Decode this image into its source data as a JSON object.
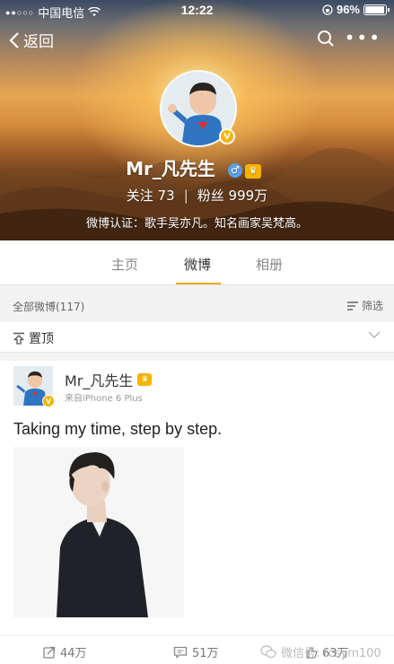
{
  "status_bar": {
    "carrier": "中国电信",
    "time": "12:22",
    "battery": "96%"
  },
  "nav": {
    "back_label": "返回"
  },
  "profile": {
    "name": "Mr_凡先生",
    "follow_label": "关注",
    "follow_count": "73",
    "fans_label": "粉丝",
    "fans_count": "999万",
    "verification": "微博认证：歌手吴亦凡。知名画家吴梵高。"
  },
  "tabs": [
    {
      "label": "主页"
    },
    {
      "label": "微博"
    },
    {
      "label": "相册"
    }
  ],
  "active_tab": "微博",
  "filter_bar": {
    "all_posts_label": "全部微博(117)",
    "filter_label": "筛选"
  },
  "pinned": {
    "label": "置顶"
  },
  "post": {
    "author": "Mr_凡先生",
    "source": "来自iPhone 6 Plus",
    "text": "Taking my time, step by step.",
    "reposts": "44万",
    "comments": "51万",
    "likes": "63万"
  },
  "watermark": "微信号: tcsym100",
  "colors": {
    "accent": "#f5a623",
    "verified": "#f5b400"
  }
}
